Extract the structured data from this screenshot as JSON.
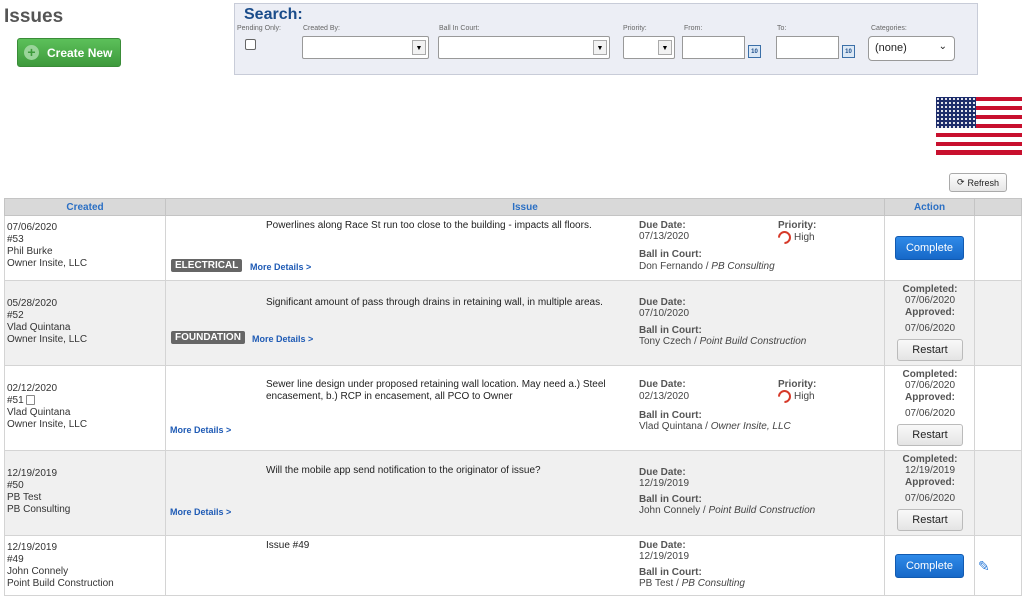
{
  "header": {
    "title": "Issues",
    "create_label": "Create New"
  },
  "search": {
    "title": "Search:",
    "pending_label": "Pending Only:",
    "created_by_label": "Created By:",
    "ball_in_court_label": "Ball In Court:",
    "priority_label": "Priority:",
    "from_label": "From:",
    "to_label": "To:",
    "categories_label": "Categories:",
    "categories_value": "(none)"
  },
  "toolbar": {
    "refresh_label": "Refresh"
  },
  "table": {
    "headers": {
      "created": "Created",
      "issue": "Issue",
      "action": "Action"
    },
    "due_label": "Due Date:",
    "priority_label": "Priority:",
    "bic_label": "Ball in Court:",
    "completed_label": "Completed:",
    "approved_label": "Approved:",
    "more_details": "More Details >",
    "complete_label": "Complete",
    "restart_label": "Restart",
    "rows": [
      {
        "date": "07/06/2020",
        "num": "#53",
        "person": "Phil Burke",
        "company": "Owner Insite, LLC",
        "text": "Powerlines along Race St run too close to the building - impacts all floors.",
        "category": "ELECTRICAL",
        "due": "07/13/2020",
        "priority": "High",
        "bic_person": "Don Fernando",
        "bic_company": "PB Consulting"
      },
      {
        "date": "05/28/2020",
        "num": "#52",
        "person": "Vlad Quintana",
        "company": "Owner Insite, LLC",
        "text": "Significant amount of pass through drains in retaining wall, in multiple areas.",
        "category": "FOUNDATION",
        "due": "07/10/2020",
        "bic_person": "Tony Czech",
        "bic_company": "Point Build Construction",
        "completed": "07/06/2020",
        "approved": "07/06/2020"
      },
      {
        "date": "02/12/2020",
        "num": "#51",
        "person": "Vlad Quintana",
        "company": "Owner Insite, LLC",
        "text": "Sewer line design under proposed retaining wall location. May need a.) Steel encasement, b.) RCP in encasement, all PCO to Owner",
        "due": "02/13/2020",
        "priority": "High",
        "bic_person": "Vlad Quintana",
        "bic_company": "Owner Insite, LLC",
        "completed": "07/06/2020",
        "approved": "07/06/2020"
      },
      {
        "date": "12/19/2019",
        "num": "#50",
        "person": "PB Test",
        "company": "PB Consulting",
        "text": "Will the mobile app send notification to the originator of issue?",
        "due": "12/19/2019",
        "bic_person": "John Connely",
        "bic_company": "Point Build Construction",
        "completed": "12/19/2019",
        "approved": "07/06/2020"
      },
      {
        "date": "12/19/2019",
        "num": "#49",
        "person": "John Connely",
        "company": "Point Build Construction",
        "text": "Issue #49",
        "due": "12/19/2019",
        "bic_person": "PB Test",
        "bic_company": "PB Consulting"
      }
    ]
  }
}
